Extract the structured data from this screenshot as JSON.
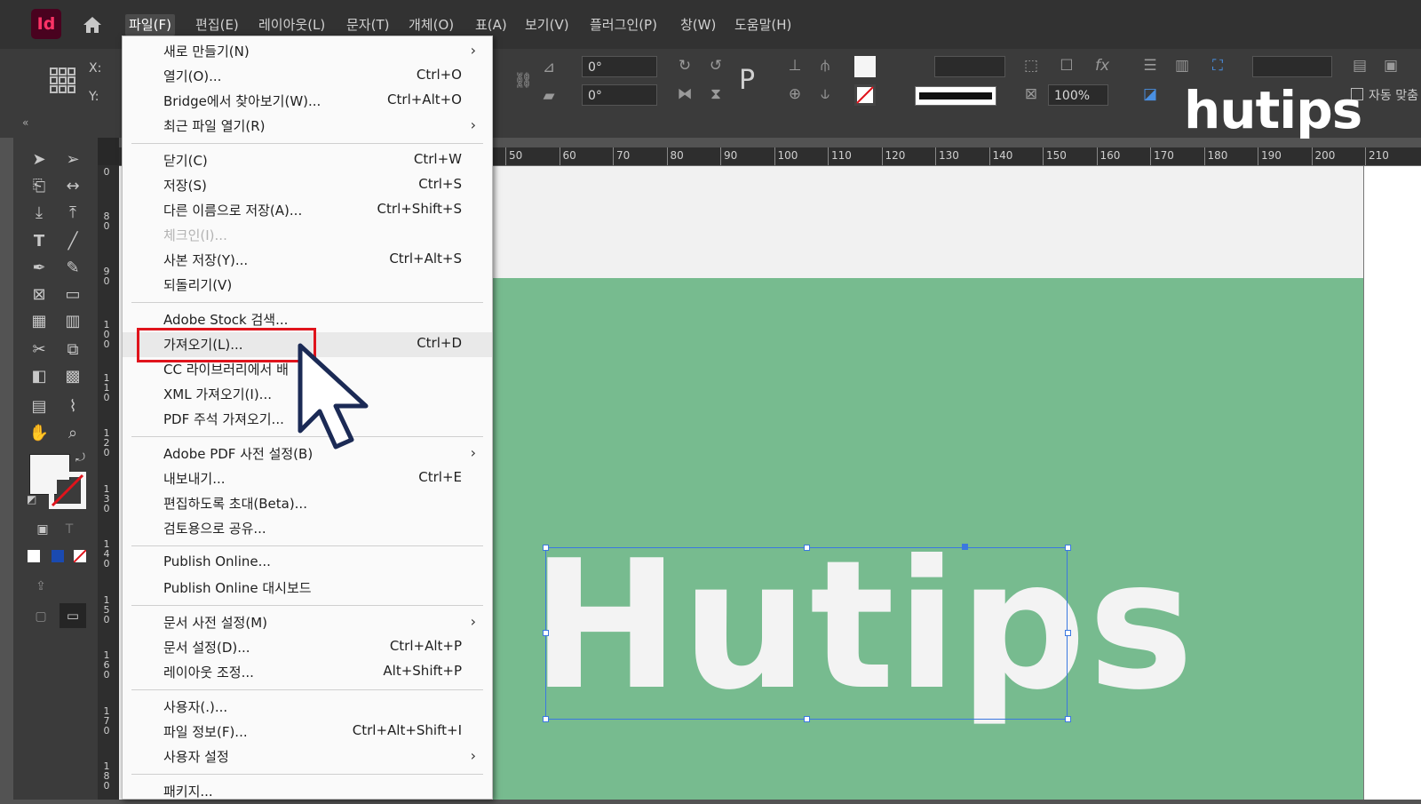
{
  "app": {
    "logo": "Id"
  },
  "menubar": {
    "items": [
      "파일(F)",
      "편집(E)",
      "레이아웃(L)",
      "문자(T)",
      "개체(O)",
      "표(A)",
      "보기(V)",
      "플러그인(P)",
      "창(W)",
      "도움말(H)"
    ]
  },
  "control": {
    "x_label": "X:",
    "y_label": "Y:",
    "rotate_value": "0°",
    "shear_value": "0°",
    "scale_value": "100%",
    "autofit_label": "자동 맞춤"
  },
  "ruler": {
    "top_labels": [
      "50",
      "60",
      "70",
      "80",
      "90",
      "100",
      "110",
      "120",
      "130",
      "140",
      "150",
      "160",
      "170",
      "180",
      "190",
      "200",
      "210"
    ],
    "left_labels": [
      "0",
      "8 0",
      "9 0",
      "1 0 0",
      "1 1 0",
      "1 2 0",
      "1 3 0",
      "1 4 0",
      "1 5 0",
      "1 6 0",
      "1 7 0",
      "1 8 0"
    ]
  },
  "document": {
    "text": "Hutips"
  },
  "watermark": "hutips",
  "file_menu": {
    "items": [
      {
        "label": "새로 만들기(N)",
        "shortcut": "",
        "submenu": true,
        "disabled": false
      },
      {
        "label": "열기(O)...",
        "shortcut": "Ctrl+O",
        "submenu": false,
        "disabled": false
      },
      {
        "label": "Bridge에서 찾아보기(W)...",
        "shortcut": "Ctrl+Alt+O",
        "submenu": false,
        "disabled": false
      },
      {
        "label": "최근 파일 열기(R)",
        "shortcut": "",
        "submenu": true,
        "disabled": false
      },
      {
        "label": "닫기(C)",
        "shortcut": "Ctrl+W",
        "submenu": false,
        "disabled": false
      },
      {
        "label": "저장(S)",
        "shortcut": "Ctrl+S",
        "submenu": false,
        "disabled": false
      },
      {
        "label": "다른 이름으로 저장(A)...",
        "shortcut": "Ctrl+Shift+S",
        "submenu": false,
        "disabled": false
      },
      {
        "label": "체크인(I)...",
        "shortcut": "",
        "submenu": false,
        "disabled": true
      },
      {
        "label": "사본 저장(Y)...",
        "shortcut": "Ctrl+Alt+S",
        "submenu": false,
        "disabled": false
      },
      {
        "label": "되돌리기(V)",
        "shortcut": "",
        "submenu": false,
        "disabled": false
      },
      {
        "label": "Adobe Stock 검색...",
        "shortcut": "",
        "submenu": false,
        "disabled": false
      },
      {
        "label": "가져오기(L)...",
        "shortcut": "Ctrl+D",
        "submenu": false,
        "disabled": false
      },
      {
        "label": "CC 라이브러리에서 배",
        "shortcut": "",
        "submenu": false,
        "disabled": false
      },
      {
        "label": "XML 가져오기(I)...",
        "shortcut": "",
        "submenu": false,
        "disabled": false
      },
      {
        "label": "PDF 주석 가져오기...",
        "shortcut": "",
        "submenu": false,
        "disabled": false
      },
      {
        "label": "Adobe PDF 사전 설정(B)",
        "shortcut": "",
        "submenu": true,
        "disabled": false
      },
      {
        "label": "내보내기...",
        "shortcut": "Ctrl+E",
        "submenu": false,
        "disabled": false
      },
      {
        "label": "편집하도록 초대(Beta)...",
        "shortcut": "",
        "submenu": false,
        "disabled": false
      },
      {
        "label": "검토용으로 공유...",
        "shortcut": "",
        "submenu": false,
        "disabled": false
      },
      {
        "label": "Publish Online...",
        "shortcut": "",
        "submenu": false,
        "disabled": false
      },
      {
        "label": "Publish Online 대시보드",
        "shortcut": "",
        "submenu": false,
        "disabled": false
      },
      {
        "label": "문서 사전 설정(M)",
        "shortcut": "",
        "submenu": true,
        "disabled": false
      },
      {
        "label": "문서 설정(D)...",
        "shortcut": "Ctrl+Alt+P",
        "submenu": false,
        "disabled": false
      },
      {
        "label": "레이아웃 조정...",
        "shortcut": "Alt+Shift+P",
        "submenu": false,
        "disabled": false
      },
      {
        "label": "사용자(.)...",
        "shortcut": "",
        "submenu": false,
        "disabled": false
      },
      {
        "label": "파일 정보(F)...",
        "shortcut": "Ctrl+Alt+Shift+I",
        "submenu": false,
        "disabled": false
      },
      {
        "label": "사용자 설정",
        "shortcut": "",
        "submenu": true,
        "disabled": false
      },
      {
        "label": "패키지...",
        "shortcut": "",
        "submenu": false,
        "disabled": false
      }
    ]
  },
  "colors": {
    "accent": "#e0141c",
    "page": "#77bb8f",
    "selection": "#3b78e0"
  }
}
